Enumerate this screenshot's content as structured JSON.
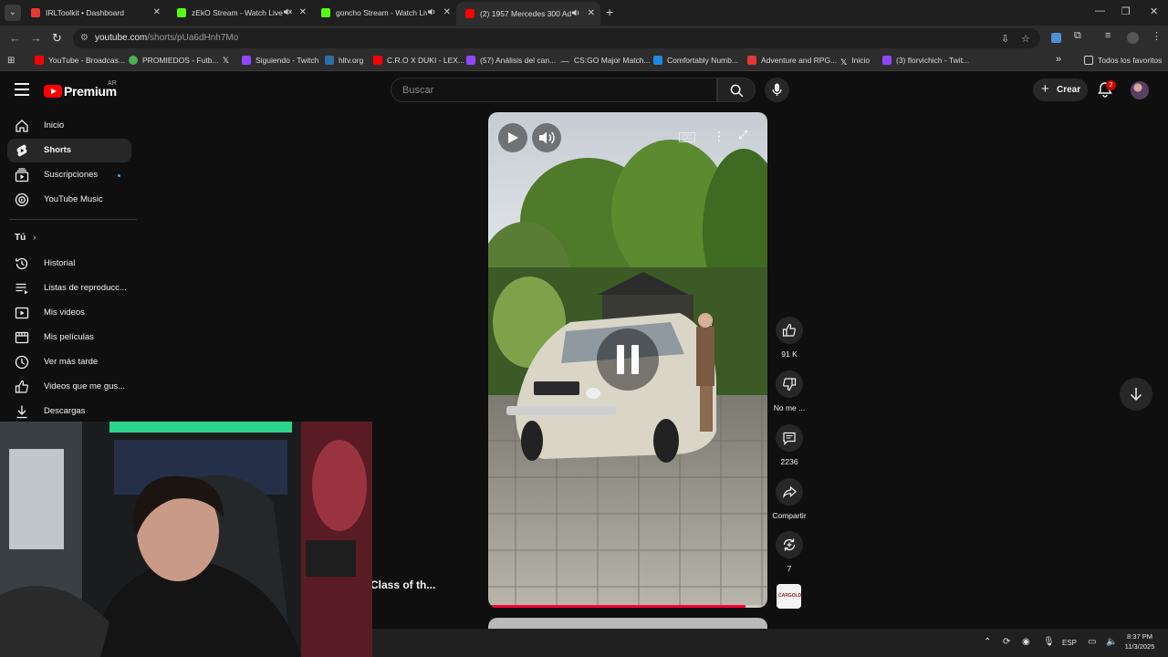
{
  "browser": {
    "tabs": [
      {
        "title": "IRLToolkit • Dashboard",
        "favicon_color": "#e53935",
        "active": false
      },
      {
        "title": "zEkO Stream - Watch Live o",
        "favicon_color": "#53fc18",
        "active": false,
        "indicator": "muted-icon"
      },
      {
        "title": "goncho Stream - Watch Live o",
        "favicon_color": "#53fc18",
        "active": false,
        "indicator": "speaker-icon"
      },
      {
        "title": "(2) 1957 Mercedes 300 Ade",
        "favicon_color": "#ff0000",
        "active": true,
        "indicator": "speaker-icon"
      }
    ],
    "new_tab": "+",
    "url_host": "youtube.com",
    "url_path": "/shorts/pUa6dHnh7Mo",
    "bookmarks": [
      {
        "label": "YouTube - Broadcas...",
        "color": "#ff0000"
      },
      {
        "label": "PROMIEDOS - Futb...",
        "color": "#4caf50"
      },
      {
        "label": "",
        "color": "#ffffff",
        "icon": "x-logo-icon"
      },
      {
        "label": "Siguiendo - Twitch",
        "color": "#9146ff"
      },
      {
        "label": "hltv.org",
        "color": "#2b6ea8"
      },
      {
        "label": "C.R.O X DUKI - LEX...",
        "color": "#ff0000"
      },
      {
        "label": "(57) Análisis del can...",
        "color": "#9146ff"
      },
      {
        "label": "CS:GO Major Match...",
        "color": "#9e9e9e"
      },
      {
        "label": "Comfortably Numb...",
        "color": "#1e88e5"
      },
      {
        "label": "Adventure and RPG...",
        "color": "#e53935"
      },
      {
        "label": "Inicio",
        "color": "#ffffff",
        "icon": "x-logo-icon"
      },
      {
        "label": "(3) florvichich - Twit...",
        "color": "#9146ff"
      }
    ],
    "bookmarks_overflow": "»",
    "all_favorites": "Todos los favoritos"
  },
  "youtube": {
    "logo_text": "Premium",
    "country_code": "AR",
    "search_placeholder": "Buscar",
    "create_label": "Crear",
    "notification_count": "2",
    "sidebar_main": [
      {
        "label": "Inicio",
        "icon": "home-icon",
        "active": false
      },
      {
        "label": "Shorts",
        "icon": "shorts-icon",
        "active": true
      },
      {
        "label": "Suscripciones",
        "icon": "subscriptions-icon",
        "active": false,
        "new_dot": true
      },
      {
        "label": "YouTube Music",
        "icon": "youtube-music-icon",
        "active": false
      }
    ],
    "you_section": "Tú",
    "sidebar_you": [
      {
        "label": "Historial",
        "icon": "history-icon"
      },
      {
        "label": "Listas de reproducc...",
        "icon": "playlists-icon"
      },
      {
        "label": "Mis videos",
        "icon": "my-videos-icon"
      },
      {
        "label": "Mis películas",
        "icon": "movies-icon"
      },
      {
        "label": "Ver más tarde",
        "icon": "watch-later-icon"
      },
      {
        "label": "Videos que me gus...",
        "icon": "liked-icon"
      },
      {
        "label": "Descargas",
        "icon": "download-icon"
      }
    ],
    "short": {
      "title_fragment": "Class of th...",
      "progress_fraction": 0.92,
      "likes": "91 K",
      "dislike_label": "No me ...",
      "comments": "2236",
      "share_label": "Compartir",
      "remix_count": "7",
      "channel_badge": "CARGOLD"
    }
  },
  "taskbar": {
    "language": "ESP",
    "time": "8:37 PM",
    "date": "11/3/2025"
  }
}
